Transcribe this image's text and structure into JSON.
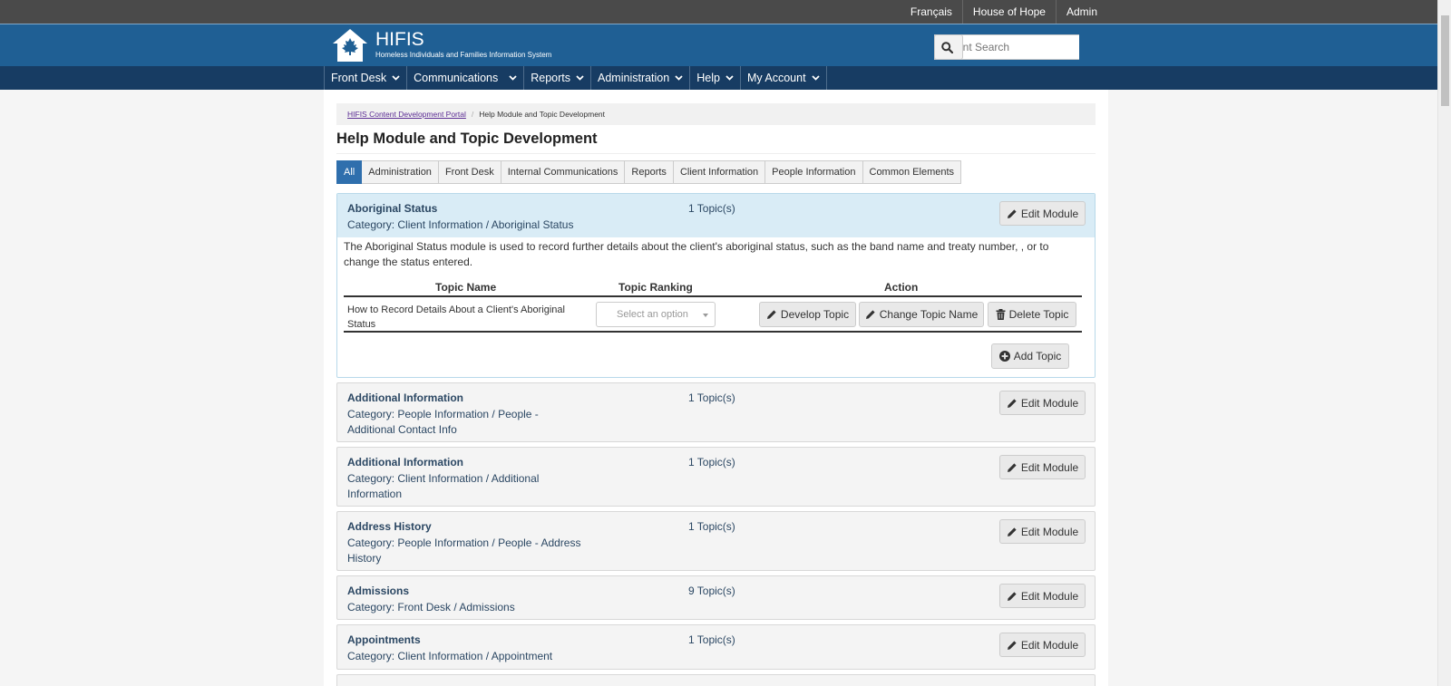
{
  "topbar": {
    "links": [
      "Français",
      "House of Hope",
      "Admin"
    ]
  },
  "brand": {
    "title": "HIFIS",
    "subtitle": "Homeless Individuals and Families Information System"
  },
  "search": {
    "placeholder": "Client Search"
  },
  "nav": {
    "items": [
      "Front Desk",
      "Communications",
      "Reports",
      "Administration",
      "Help",
      "My Account"
    ]
  },
  "breadcrumb": {
    "link": "HIFIS Content Development Portal",
    "current": "Help Module and Topic Development"
  },
  "page": {
    "title": "Help Module and Topic Development"
  },
  "tabs": [
    "All",
    "Administration",
    "Front Desk",
    "Internal Communications",
    "Reports",
    "Client Information",
    "People Information",
    "Common Elements"
  ],
  "expanded_module": {
    "title": "Aboriginal Status",
    "category": "Category: Client Information / Aboriginal Status",
    "topics": "1 Topic(s)",
    "edit_label": "Edit Module",
    "description": "The Aboriginal Status module is used to record further details about the client's aboriginal status, such as the band name and treaty number, , or to change the status entered.",
    "table_headers": [
      "Topic Name",
      "Topic Ranking",
      "Action"
    ],
    "row": {
      "topic_name": "How to Record Details About a Client's Aboriginal Status",
      "ranking_placeholder": "Select an option",
      "develop_label": "Develop Topic",
      "rename_label": "Change Topic Name",
      "delete_label": "Delete Topic"
    },
    "add_label": "Add Topic"
  },
  "modules": [
    {
      "title": "Additional Information",
      "category": "Category: People Information / People - Additional Contact Info",
      "topics": "1 Topic(s)",
      "edit_label": "Edit Module"
    },
    {
      "title": "Additional Information",
      "category": "Category: Client Information / Additional Information",
      "topics": "1 Topic(s)",
      "edit_label": "Edit Module"
    },
    {
      "title": "Address History",
      "category": "Category: People Information / People - Address History",
      "topics": "1 Topic(s)",
      "edit_label": "Edit Module"
    },
    {
      "title": "Admissions",
      "category": "Category: Front Desk / Admissions",
      "topics": "9 Topic(s)",
      "edit_label": "Edit Module"
    },
    {
      "title": "Appointments",
      "category": "Category: Client Information / Appointment",
      "topics": "1 Topic(s)",
      "edit_label": "Edit Module"
    }
  ],
  "colors": {
    "header": "#1f5f94",
    "nav": "#173c63",
    "topbar": "#4a4a4a",
    "active_tab": "#2f6fad",
    "expanded_head": "#d9ecf6"
  },
  "icons": [
    "maple-leaf-house-icon",
    "search-icon",
    "chevron-down-icon",
    "pencil-icon",
    "trash-icon",
    "plus-circle-icon"
  ]
}
